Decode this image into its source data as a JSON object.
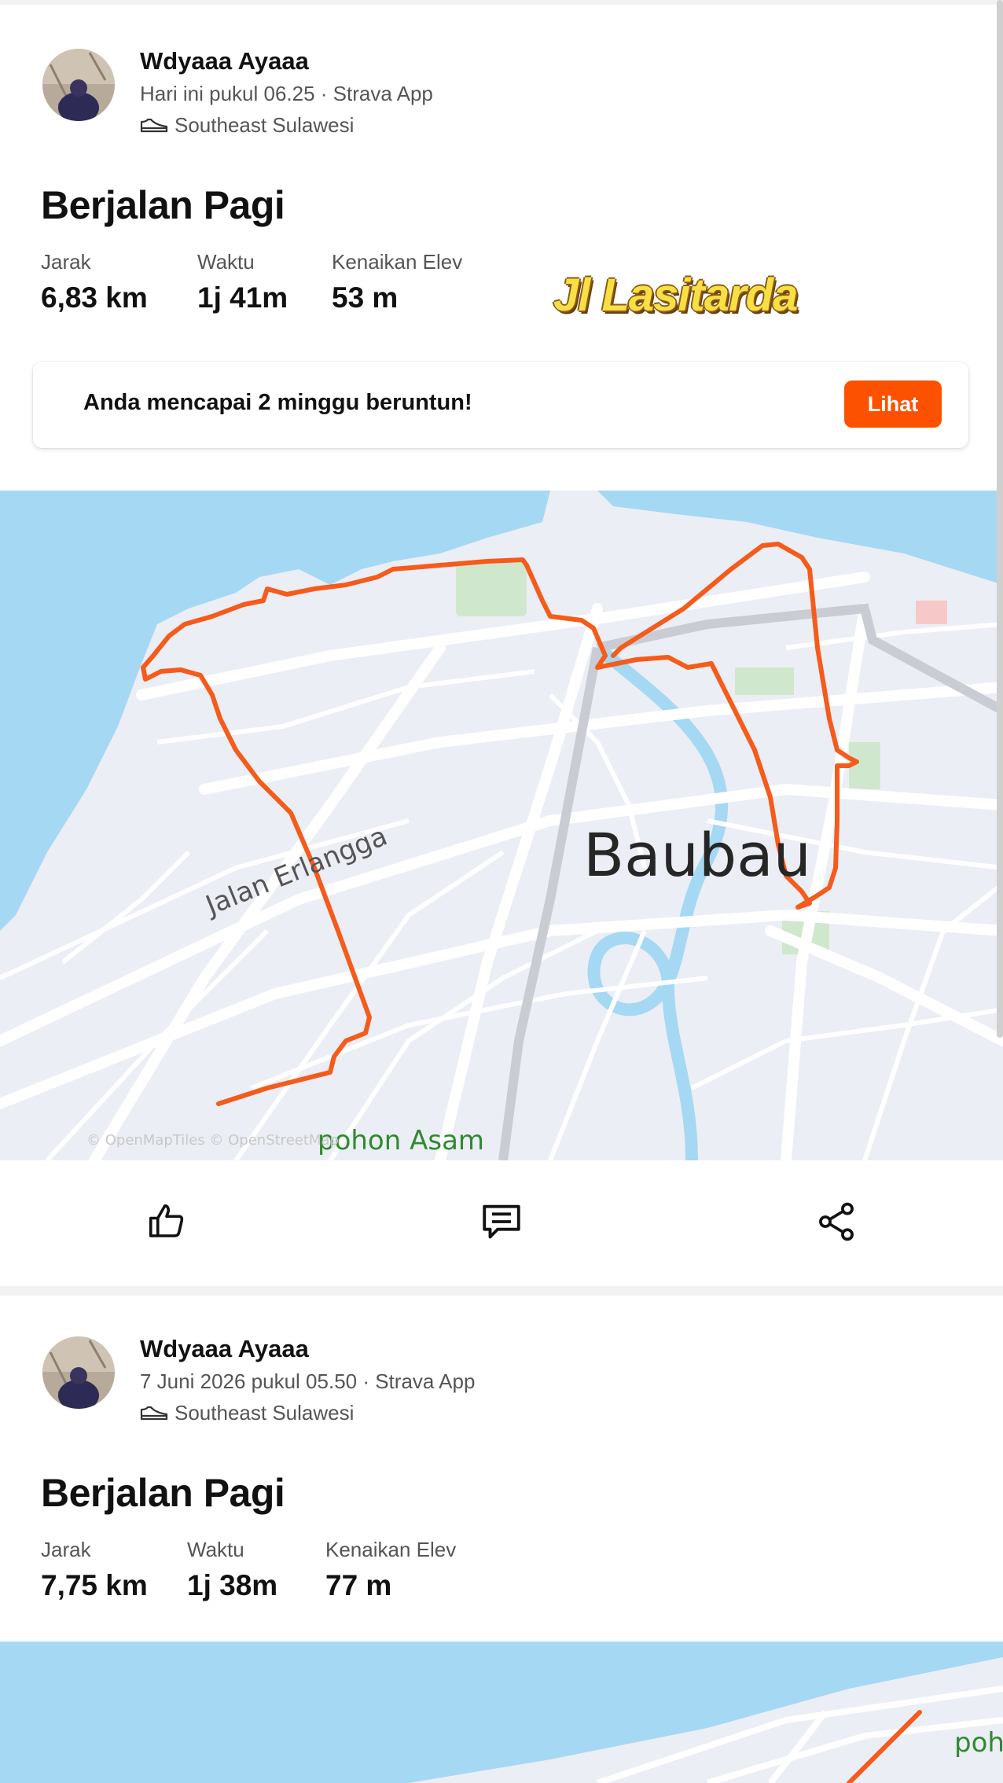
{
  "colors": {
    "accent": "#fc5200",
    "route": "#f55b1a",
    "water": "#a5d8f3",
    "land": "#eceef5",
    "park": "#cfe8cd"
  },
  "activities": [
    {
      "athlete": "Wdyaaa Ayaaa",
      "meta": "Hari ini pukul 06.25 · Strava App",
      "location": "Southeast Sulawesi",
      "location_icon": "shoe-icon",
      "title": "Berjalan Pagi",
      "stats": [
        {
          "label": "Jarak",
          "value": "6,83 km"
        },
        {
          "label": "Waktu",
          "value": "1j 41m"
        },
        {
          "label": "Kenaikan Elev",
          "value": "53 m"
        }
      ],
      "sticker": "Jl Lasitarda",
      "streak": {
        "text": "Anda mencapai 2 minggu beruntun!",
        "button": "Lihat"
      },
      "map": {
        "city_label": "Baubau",
        "street_label": "Jalan Erlangga",
        "bottom_label": "pohon Asam",
        "attribution": "© OpenMapTiles © OpenStreetMap"
      },
      "actions": [
        "like-icon",
        "comment-icon",
        "share-icon"
      ]
    },
    {
      "athlete": "Wdyaaa Ayaaa",
      "meta": "7 Juni 2026 pukul 05.50 · Strava App",
      "location": "Southeast Sulawesi",
      "location_icon": "shoe-icon",
      "title": "Berjalan Pagi",
      "stats": [
        {
          "label": "Jarak",
          "value": "7,75 km"
        },
        {
          "label": "Waktu",
          "value": "1j 38m"
        },
        {
          "label": "Kenaikan Elev",
          "value": "77 m"
        }
      ],
      "map": {
        "bottom_label": "poh"
      }
    }
  ]
}
